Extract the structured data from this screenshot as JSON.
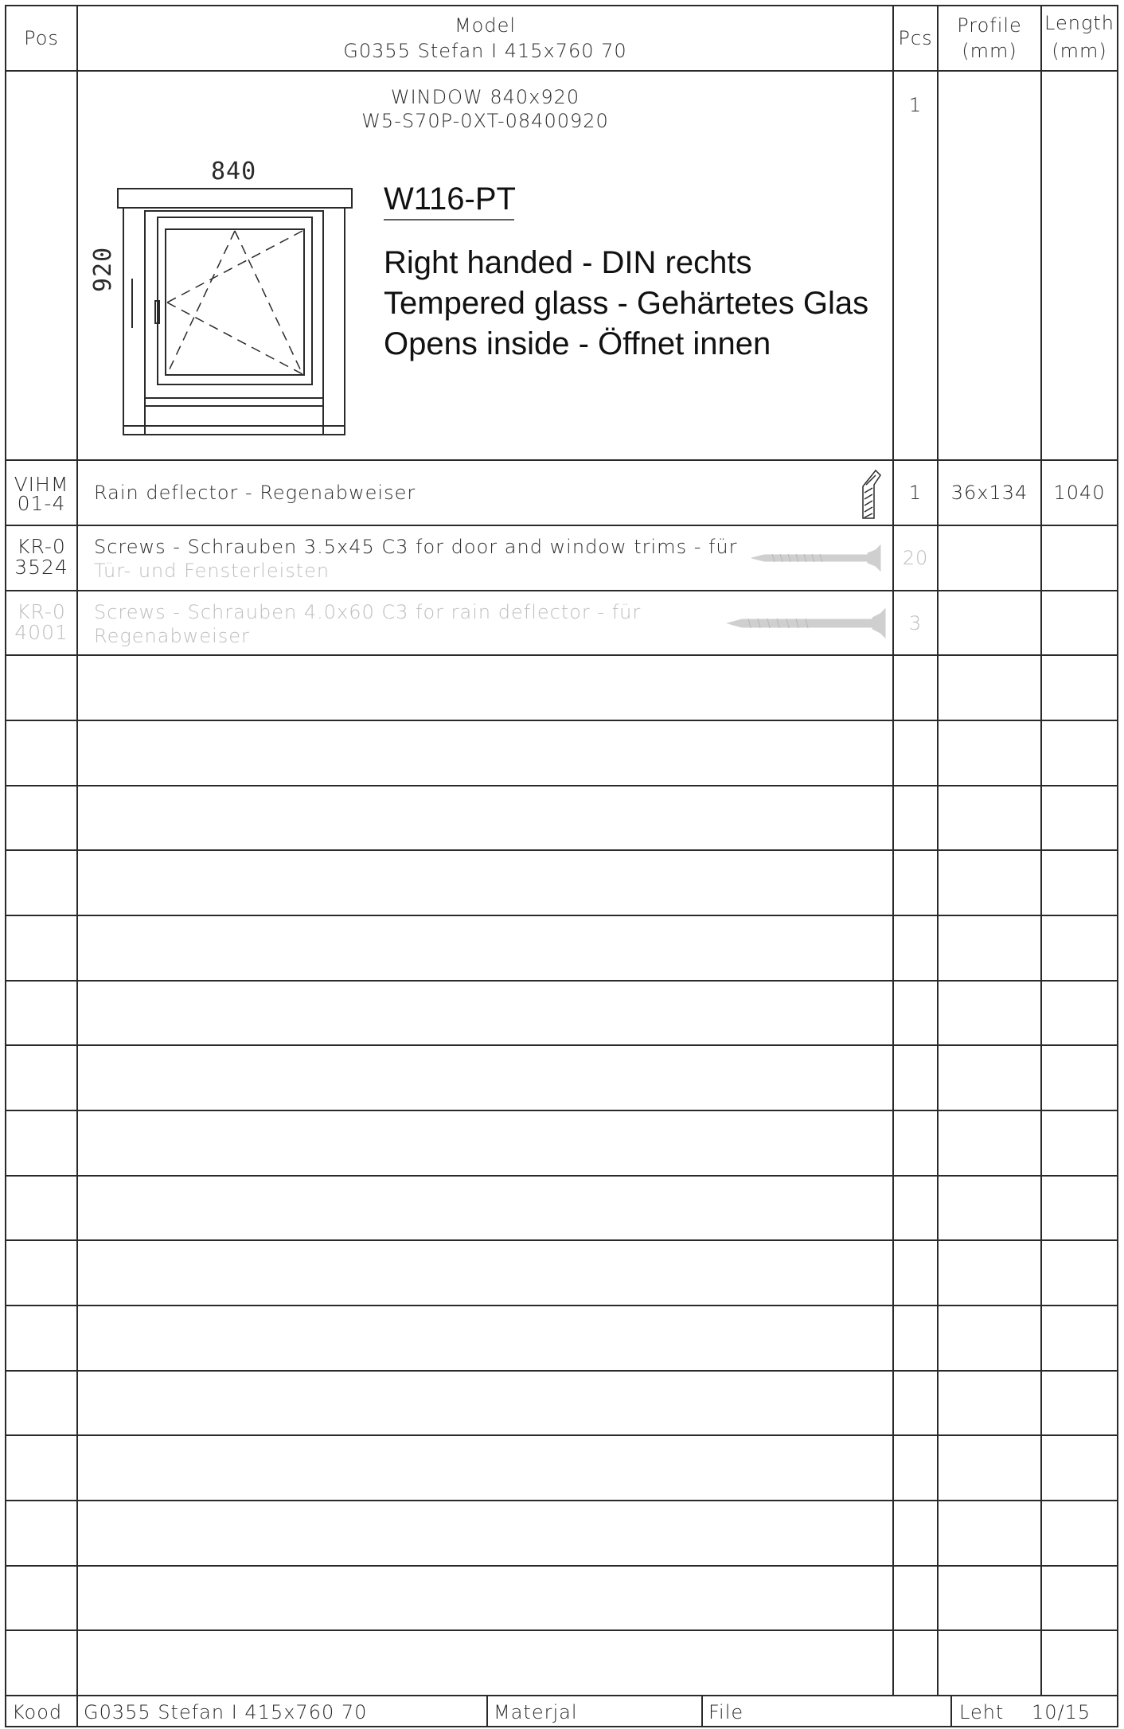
{
  "header": {
    "pos": "Pos",
    "model_label": "Model",
    "model_value": "G0355 Stefan I 415x760 70",
    "pcs": "Pcs",
    "profile_label": "Profile",
    "profile_unit": "(mm)",
    "length_label": "Length",
    "length_unit": "(mm)"
  },
  "window_item": {
    "title": "WINDOW 840x920",
    "code": "W5-S70P-0XT-08400920",
    "pcs": "1",
    "drawing": {
      "width_label": "840",
      "height_label": "920",
      "type_code": "W116-PT",
      "notes": [
        "Right handed - DIN rechts",
        "Tempered glass - Gehärtetes Glas",
        "Opens inside - Öffnet innen"
      ]
    }
  },
  "rows": [
    {
      "pos_line1": "VIHM",
      "pos_line2": "01-4",
      "desc_line1": "Rain deflector - Regenabweiser",
      "desc_line2": "",
      "pcs": "1",
      "profile": "36x134",
      "length": "1040",
      "icon": "profile-section-icon"
    },
    {
      "pos_line1": "KR-0",
      "pos_line2": "3524",
      "desc_line1": "Screws - Schrauben 3.5x45 C3   for door and window trims - für",
      "desc_line2": "Tür- und Fensterleisten",
      "pcs": "20",
      "profile": "",
      "length": "",
      "icon": "screw-icon"
    },
    {
      "pos_line1": "KR-0",
      "pos_line2": "4001",
      "desc_line1": "Screws - Schrauben 4.0x60 C3   for rain deflector - für",
      "desc_line2": "Regenabweiser",
      "pcs": "3",
      "profile": "",
      "length": "",
      "icon": "screw-icon"
    }
  ],
  "footer": {
    "kood_label": "Kood",
    "kood_value": "G0355 Stefan I 415x760 70",
    "materjal_label": "Materjal",
    "file_label": "File",
    "leht_label": "Leht",
    "leht_value": "10/15"
  },
  "colors": {
    "line": "#2a2a2a",
    "text": "#2a2a2a",
    "faded_text": "#bdbdbd"
  }
}
